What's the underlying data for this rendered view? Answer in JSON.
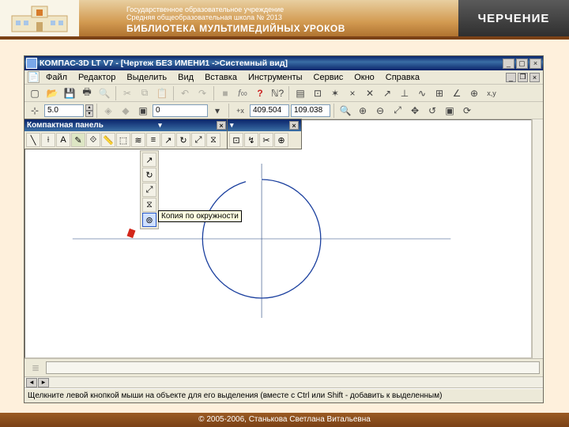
{
  "banner": {
    "line1": "Государственное образовательное учреждение",
    "line2": "Средняя общеобразовательная школа № 2013",
    "title": "БИБЛИОТЕКА МУЛЬТИМЕДИЙНЫХ УРОКОВ",
    "subject": "ЧЕРЧЕНИЕ"
  },
  "app": {
    "title": "КОМПАС-3D LT V7 - [Чертеж БЕЗ ИМЕНИ1 ->Системный вид]"
  },
  "menu": {
    "file": "Файл",
    "editor": "Редактор",
    "select": "Выделить",
    "view": "Вид",
    "insert": "Вставка",
    "tools": "Инструменты",
    "service": "Сервис",
    "window": "Окно",
    "help": "Справка"
  },
  "toolbar2": {
    "step": "5.0",
    "state": "0",
    "coord_x": "409.504",
    "coord_y": "109.038"
  },
  "compact_panel": {
    "title": "Компактная панель"
  },
  "tooltip": "Копия по окружности",
  "status": "Щелкните левой кнопкой мыши на объекте для его выделения (вместе с Ctrl или Shift - добавить к выделенным)",
  "footer": "© 2005-2006, Станькова Светлана Витальевна"
}
